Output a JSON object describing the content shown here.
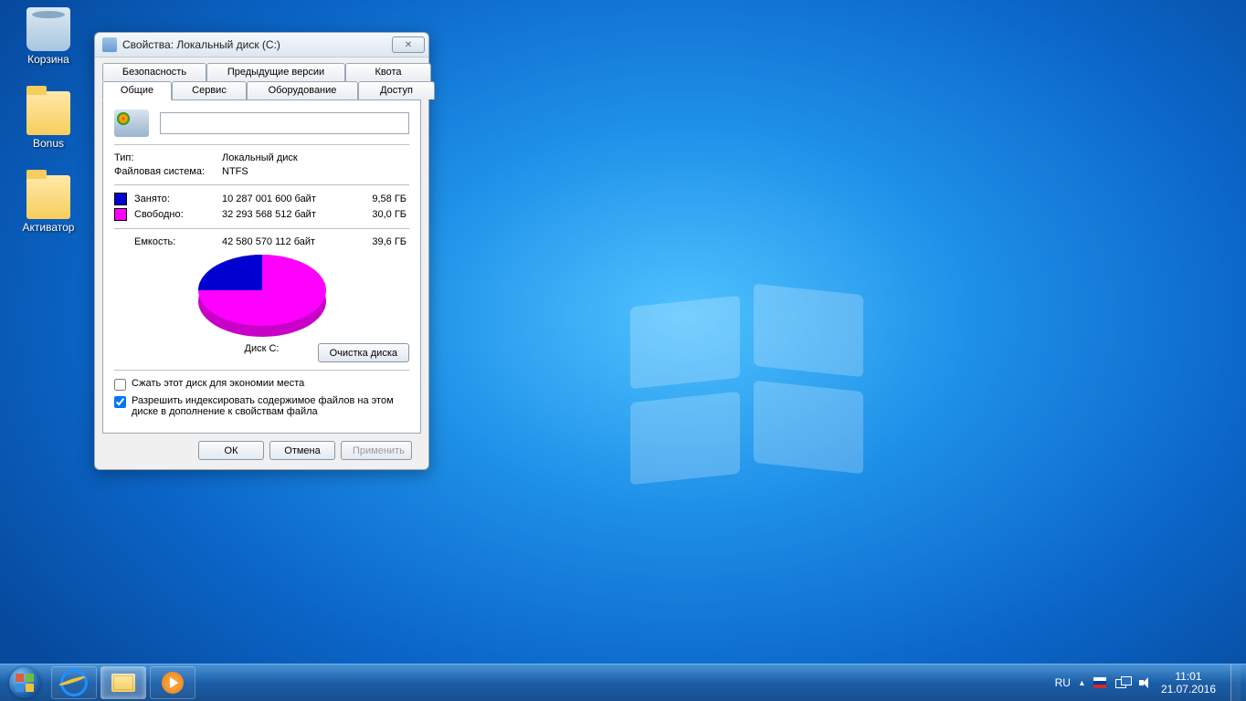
{
  "desktop_icons": [
    {
      "name": "Корзина",
      "type": "bin"
    },
    {
      "name": "Bonus",
      "type": "folder"
    },
    {
      "name": "Активатор",
      "type": "folder"
    }
  ],
  "dialog": {
    "title": "Свойства: Локальный диск (C:)",
    "tabs_row1": [
      "Безопасность",
      "Предыдущие версии",
      "Квота"
    ],
    "tabs_row2": [
      "Общие",
      "Сервис",
      "Оборудование",
      "Доступ"
    ],
    "active_tab": "Общие",
    "type_label": "Тип:",
    "type_value": "Локальный диск",
    "fs_label": "Файловая система:",
    "fs_value": "NTFS",
    "used_label": "Занято:",
    "used_bytes": "10 287 001 600 байт",
    "used_size": "9,58 ГБ",
    "free_label": "Свободно:",
    "free_bytes": "32 293 568 512 байт",
    "free_size": "30,0 ГБ",
    "cap_label": "Емкость:",
    "cap_bytes": "42 580 570 112 байт",
    "cap_size": "39,6 ГБ",
    "disk_label": "Диск C:",
    "cleanup_btn": "Очистка диска",
    "compress_chk": "Сжать этот диск для экономии места",
    "index_chk": "Разрешить индексировать содержимое файлов на этом диске в дополнение к свойствам файла",
    "compress_checked": false,
    "index_checked": true,
    "ok_btn": "ОК",
    "cancel_btn": "Отмена",
    "apply_btn": "Применить"
  },
  "taskbar": {
    "lang": "RU",
    "time": "11:01",
    "date": "21.07.2016"
  },
  "colors": {
    "used": "#0000d0",
    "free": "#ff00ff"
  }
}
